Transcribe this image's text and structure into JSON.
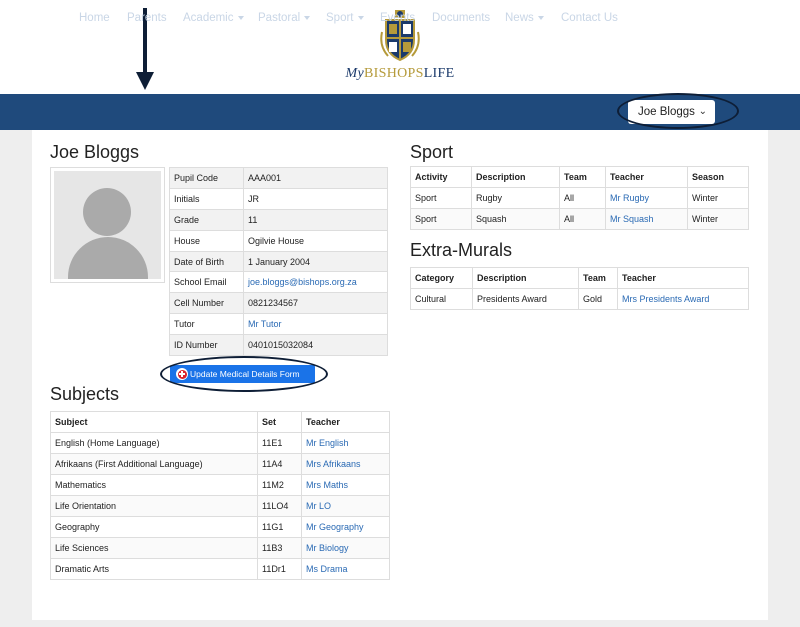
{
  "brand": {
    "my": "My",
    "bishops": "BISHOPS",
    "life": "LIFE"
  },
  "crest_icon": "school-crest-logo",
  "colors": {
    "navbar": "#1f4a7c",
    "link": "#2a6ab4",
    "button": "#1a73e8",
    "annotation": "#0e1e36"
  },
  "nav": {
    "items": [
      {
        "label": "Home"
      },
      {
        "label": "Parents"
      },
      {
        "label": "Academic"
      },
      {
        "label": "Pastoral"
      },
      {
        "label": "Sport"
      },
      {
        "label": "Events"
      },
      {
        "label": "Documents"
      },
      {
        "label": "News"
      },
      {
        "label": "Contact Us"
      }
    ],
    "user_select": "Joe Bloggs"
  },
  "profile": {
    "name": "Joe Bloggs",
    "fields": [
      {
        "label": "Pupil Code",
        "value": "AAA001"
      },
      {
        "label": "Initials",
        "value": "JR"
      },
      {
        "label": "Grade",
        "value": "11"
      },
      {
        "label": "House",
        "value": "Ogilvie House"
      },
      {
        "label": "Date of Birth",
        "value": "1 January 2004"
      },
      {
        "label": "School Email",
        "value": "joe.bloggs@bishops.org.za"
      },
      {
        "label": "Cell Number",
        "value": "0821234567"
      },
      {
        "label": "Tutor",
        "value": "Mr Tutor"
      },
      {
        "label": "ID Number",
        "value": "0401015032084"
      }
    ],
    "medical_button": "Update Medical Details Form"
  },
  "subjects": {
    "title": "Subjects",
    "headers": [
      "Subject",
      "Set",
      "Teacher"
    ],
    "rows": [
      [
        "English (Home Language)",
        "11E1",
        "Mr English"
      ],
      [
        "Afrikaans (First Additional Language)",
        "11A4",
        "Mrs Afrikaans"
      ],
      [
        "Mathematics",
        "11M2",
        "Mrs Maths"
      ],
      [
        "Life Orientation",
        "11LO4",
        "Mr LO"
      ],
      [
        "Geography",
        "11G1",
        "Mr Geography"
      ],
      [
        "Life Sciences",
        "11B3",
        "Mr Biology"
      ],
      [
        "Dramatic Arts",
        "11Dr1",
        "Ms Drama"
      ]
    ]
  },
  "sport": {
    "title": "Sport",
    "headers": [
      "Activity",
      "Description",
      "Team",
      "Teacher",
      "Season"
    ],
    "rows": [
      [
        "Sport",
        "Rugby",
        "All",
        "Mr Rugby",
        "Winter"
      ],
      [
        "Sport",
        "Squash",
        "All",
        "Mr Squash",
        "Winter"
      ]
    ]
  },
  "extramurals": {
    "title": "Extra-Murals",
    "headers": [
      "Category",
      "Description",
      "Team",
      "Teacher"
    ],
    "rows": [
      [
        "Cultural",
        "Presidents Award",
        "Gold",
        "Mrs Presidents Award"
      ]
    ]
  }
}
